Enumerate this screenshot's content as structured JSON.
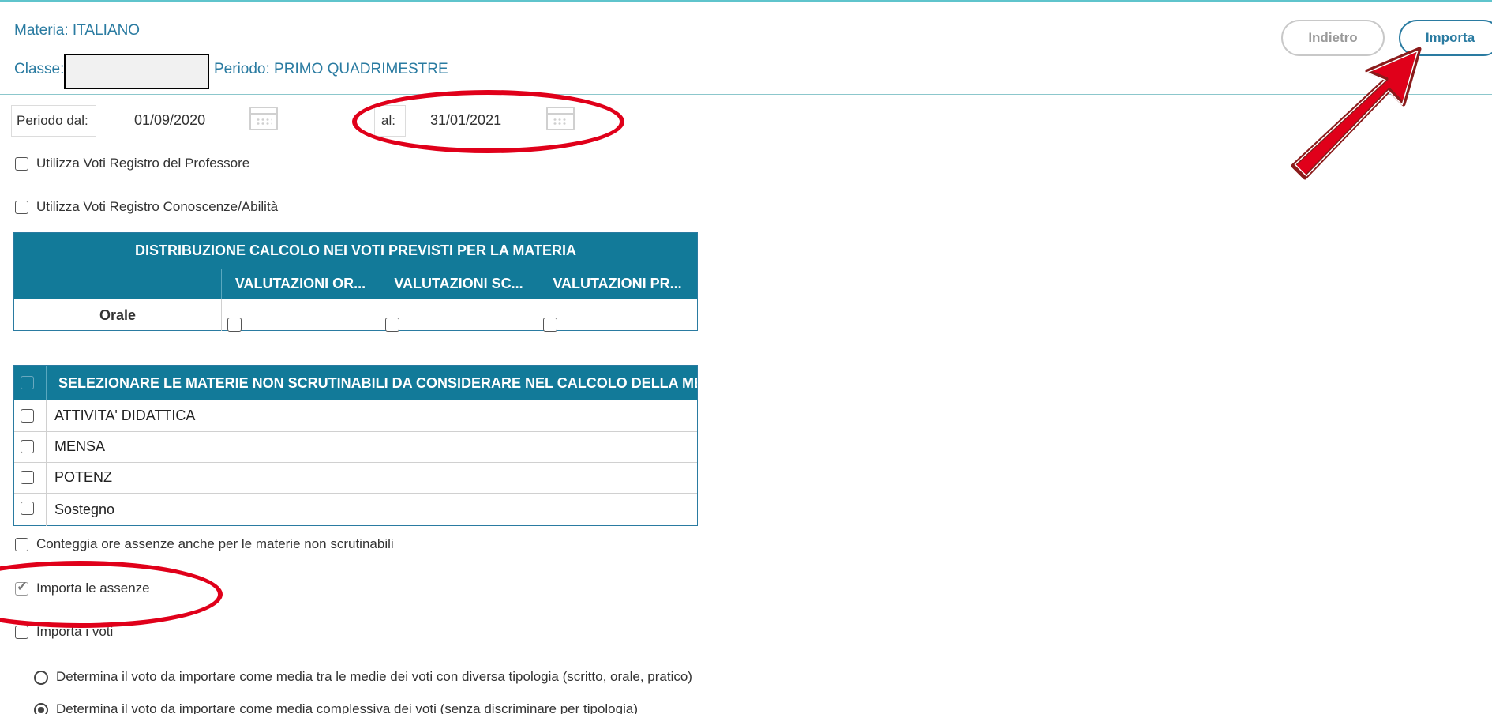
{
  "header": {
    "materia": "Materia: ITALIANO",
    "classe_label": "Classe:",
    "periodo": "Periodo: PRIMO QUADRIMESTRE"
  },
  "buttons": {
    "back": "Indietro",
    "import": "Importa"
  },
  "period": {
    "from_label": "Periodo dal:",
    "from_value": "01/09/2020",
    "to_label": "al:",
    "to_value": "31/01/2021"
  },
  "options": {
    "use_prof": {
      "label": "Utilizza Voti Registro del Professore",
      "checked": false
    },
    "use_conosc": {
      "label": "Utilizza Voti Registro Conoscenze/Abilità",
      "checked": false
    }
  },
  "distribution_table": {
    "title": "DISTRIBUZIONE CALCOLO NEI VOTI PREVISTI PER LA MATERIA",
    "columns": [
      "VALUTAZIONI OR...",
      "VALUTAZIONI SC...",
      "VALUTAZIONI PR..."
    ],
    "rows": [
      {
        "label": "Orale",
        "values": [
          false,
          false,
          false
        ]
      }
    ]
  },
  "subjects_table": {
    "title": "SELEZIONARE LE MATERIE NON SCRUTINABILI DA CONSIDERARE NEL CALCOLO DELLA MED",
    "rows": [
      "ATTIVITA' DIDATTICA",
      "MENSA",
      "POTENZ",
      "Sostegno"
    ]
  },
  "more_options": {
    "count_hours": {
      "label": "Conteggia ore assenze anche per le materie non scrutinabili",
      "checked": false
    },
    "import_absences": {
      "label": "Importa le assenze",
      "checked": true
    },
    "import_grades": {
      "label": "Importa i voti",
      "checked": false
    }
  },
  "radios": {
    "by_type": {
      "label": "Determina il voto da importare come media tra le medie dei voti con diversa tipologia (scritto, orale, pratico)",
      "selected": false
    },
    "overall": {
      "label": "Determina il voto da importare come media complessiva dei voti (senza discriminare per tipologia)",
      "selected": true
    }
  },
  "annotation_color": "#e0001a",
  "accent_color": "#127a99"
}
